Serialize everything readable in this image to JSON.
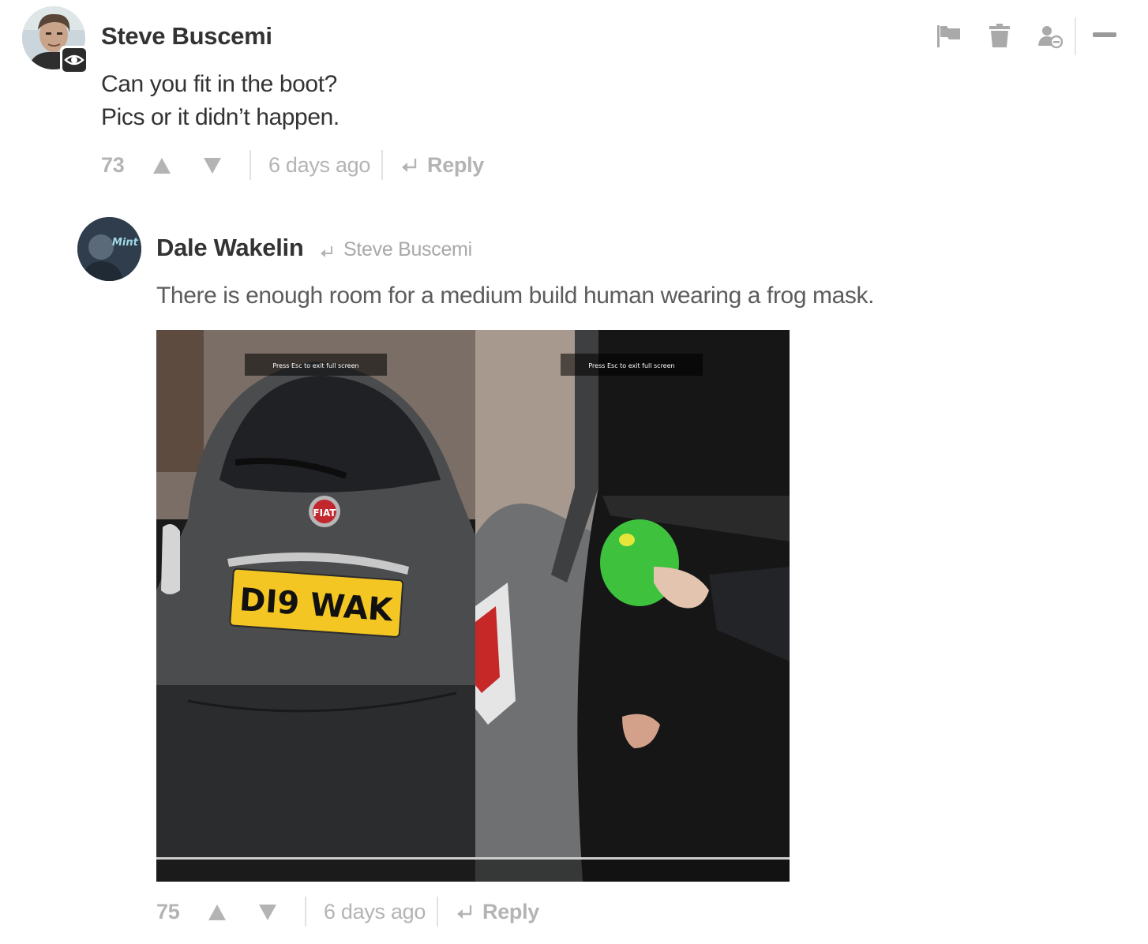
{
  "comments": [
    {
      "author": "Steve Buscemi",
      "lines": [
        "Can you fit in the boot?",
        "Pics or it didn’t happen."
      ],
      "score": "73",
      "time": "6 days ago",
      "reply_label": "Reply",
      "avatar_badge_icon": "eye-icon"
    },
    {
      "author": "Dale Wakelin",
      "reply_to": "Steve Buscemi",
      "lines": [
        "There is enough room for a medium build human wearing a frog mask."
      ],
      "score": "75",
      "time": "6 days ago",
      "reply_label": "Reply",
      "media": {
        "left_overlay": "Press Esc to exit full screen",
        "right_overlay": "Press Esc to exit full screen",
        "plate": "DI9 WAK",
        "badge_text": "FIAT",
        "avatar_text": "Mint"
      }
    }
  ],
  "toolbar": {
    "icons": [
      "flag-icon",
      "trash-icon",
      "block-user-icon",
      "collapse-icon"
    ]
  },
  "colors": {
    "author": "#333333",
    "meta": "#b4b4b4",
    "body": "#333333",
    "reply_body": "#5c5c5c",
    "toolbar_icon": "#a9a9a9"
  }
}
